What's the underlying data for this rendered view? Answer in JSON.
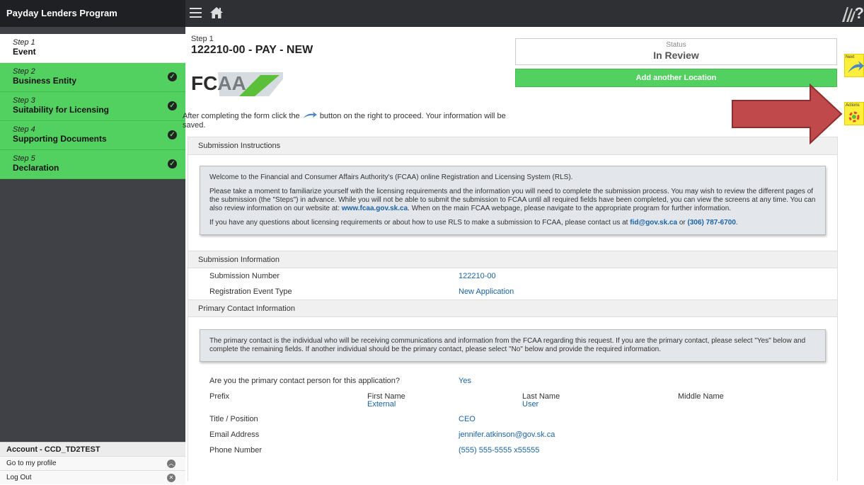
{
  "sidebar": {
    "title": "Payday Lenders Program",
    "steps": [
      {
        "num": "Step 1",
        "name": "Event"
      },
      {
        "num": "Step 2",
        "name": "Business Entity"
      },
      {
        "num": "Step 3",
        "name": "Suitability for Licensing"
      },
      {
        "num": "Step 4",
        "name": "Supporting Documents"
      },
      {
        "num": "Step 5",
        "name": "Declaration"
      }
    ],
    "account": {
      "title": "Account - CCD_TD2TEST",
      "profile": "Go to my profile",
      "logout": "Log Out"
    }
  },
  "header": {
    "help": "?"
  },
  "main": {
    "step_label": "Step 1",
    "title": "122210-00 - PAY - NEW",
    "logo_text": "FCAA",
    "status_label": "Status",
    "status_value": "In Review",
    "add_location": "Add another Location",
    "after_text_1": "After completing the form click the",
    "after_text_2": "button on the right to proceed. Your information will be saved."
  },
  "instructions": {
    "heading": "Submission Instructions",
    "p1": "Welcome to the Financial and Consumer Affairs Authority's (FCAA) online Registration and Licensing System (RLS).",
    "p2a": "Please take a moment to familiarize yourself with the licensing requirements and the information you will need to complete the submission process. You may wish to review the different pages of the submission (the \"Steps\") in advance. While you will not be able to submit the submission to FCAA until all required fields have been completed, you can view the screens at any time. You can also review information on our website at:",
    "p2_link": "www.fcaa.gov.sk.ca",
    "p2b": ". When on the main FCAA webpage, please navigate to the appropriate program for further information.",
    "p3a": "If you have any questions about licensing requirements or about how to use RLS to make a submission to FCAA, please contact us at",
    "p3_email": "fid@gov.sk.ca",
    "p3_or": "or",
    "p3_phone": "(306) 787-6700",
    "p3_end": "."
  },
  "submission": {
    "heading": "Submission Information",
    "number_label": "Submission Number",
    "number_value": "122210-00",
    "type_label": "Registration Event Type",
    "type_value": "New Application"
  },
  "contact": {
    "heading": "Primary Contact Information",
    "info": "The primary contact is the individual who will be receiving communications and information from the FCAA regarding this request. If you are the primary contact, please select \"Yes\" below and complete the remaining fields. If another individual should be the primary contact, please select \"No\" below and provide the required information.",
    "q_label": "Are you the primary contact person for this application?",
    "q_value": "Yes",
    "prefix_label": "Prefix",
    "first_label": "First Name",
    "first_value": "External",
    "last_label": "Last Name",
    "last_value": "User",
    "middle_label": "Middle Name",
    "title_label": "Title / Position",
    "title_value": "CEO",
    "email_label": "Email Address",
    "email_value": "jennifer.atkinson@gov.sk.ca",
    "phone_label": "Phone Number",
    "phone_value": "(555) 555-5555 x55555"
  },
  "rightbar": {
    "next_label": "Next",
    "actions_label": "Actions"
  },
  "colors": {
    "accent_green": "#52d060",
    "sidebar": "#3f4147",
    "link": "#1b63a4",
    "arrow_red": "#c0494b",
    "action_yellow": "#ffef3a"
  }
}
